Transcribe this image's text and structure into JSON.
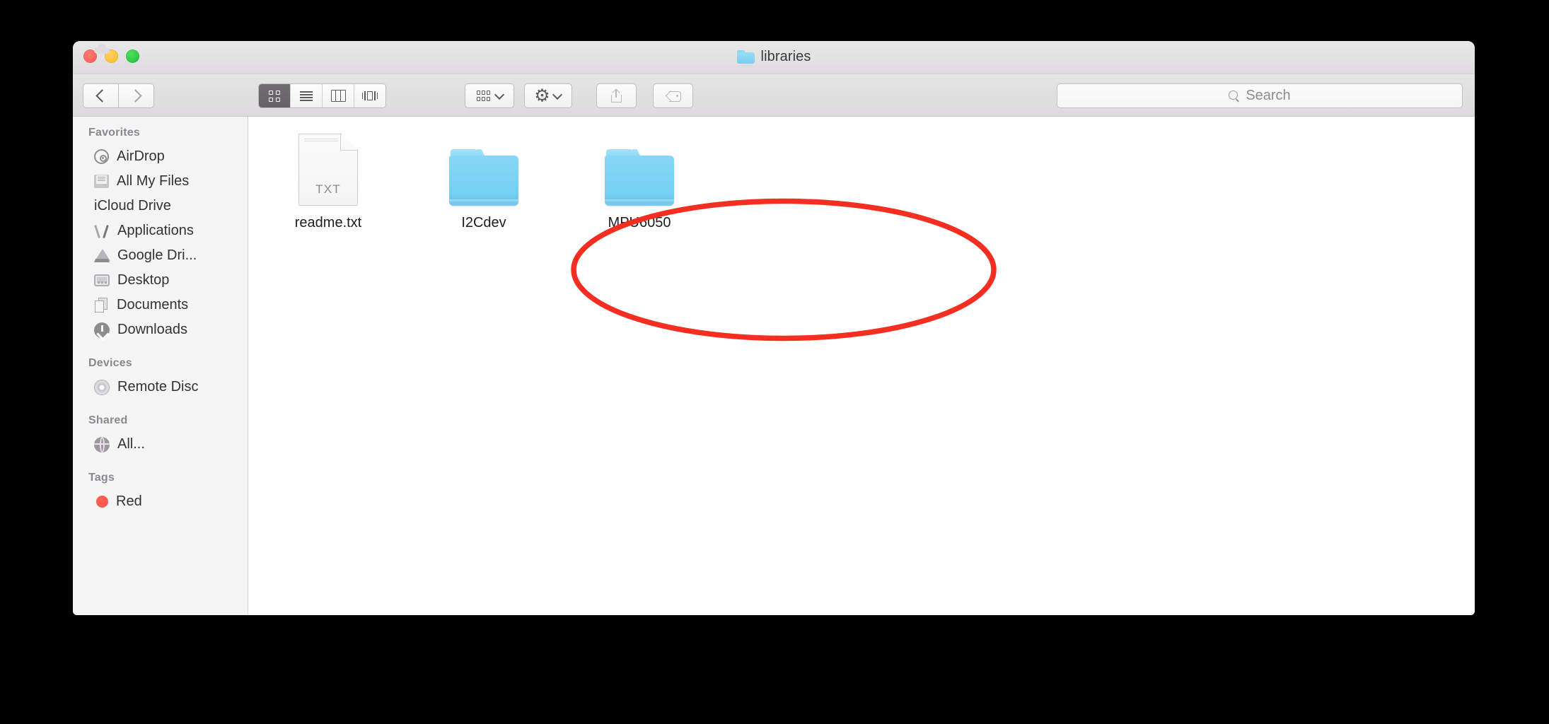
{
  "window": {
    "title": "libraries",
    "title_icon": "folder-icon",
    "traffic_lights": [
      {
        "name": "close",
        "color": "#fd5a50"
      },
      {
        "name": "minimize",
        "color": "#fcb71c"
      },
      {
        "name": "maximize",
        "color": "#1dbf32"
      }
    ]
  },
  "toolbar": {
    "nav": [
      {
        "name": "back",
        "icon": "chevron-left-icon"
      },
      {
        "name": "forward",
        "icon": "chevron-right-icon"
      }
    ],
    "view_modes": [
      {
        "name": "icon-view",
        "icon": "grid-icon",
        "active": true
      },
      {
        "name": "list-view",
        "icon": "list-icon",
        "active": false
      },
      {
        "name": "column-view",
        "icon": "columns-icon",
        "active": false
      },
      {
        "name": "cover-flow-view",
        "icon": "coverflow-icon",
        "active": false
      }
    ],
    "arrange": {
      "name": "arrange-by",
      "icon": "arrange-icon",
      "chevron": "chevron-down-icon"
    },
    "action": {
      "name": "action-menu",
      "icon": "gear-icon",
      "chevron": "chevron-down-icon"
    },
    "share": {
      "name": "share",
      "icon": "share-icon",
      "enabled": false
    },
    "tag": {
      "name": "add-tags",
      "icon": "tag-icon",
      "enabled": false
    }
  },
  "search": {
    "placeholder": "Search",
    "value": "",
    "icon": "search-icon"
  },
  "sidebar": {
    "sections": [
      {
        "header": "Favorites",
        "items": [
          {
            "label": "AirDrop",
            "icon": "airdrop-icon"
          },
          {
            "label": "All My Files",
            "icon": "all-my-files-icon"
          },
          {
            "label": "iCloud Drive",
            "icon": "icloud-icon"
          },
          {
            "label": "Applications",
            "icon": "applications-icon"
          },
          {
            "label": "Google Dri...",
            "icon": "google-drive-icon"
          },
          {
            "label": "Desktop",
            "icon": "desktop-icon"
          },
          {
            "label": "Documents",
            "icon": "documents-icon"
          },
          {
            "label": "Downloads",
            "icon": "downloads-icon"
          }
        ]
      },
      {
        "header": "Devices",
        "items": [
          {
            "label": "Remote Disc",
            "icon": "disc-icon"
          }
        ]
      },
      {
        "header": "Shared",
        "items": [
          {
            "label": "All...",
            "icon": "globe-icon"
          }
        ]
      },
      {
        "header": "Tags",
        "items": [
          {
            "label": "Red",
            "icon": "red-tag-icon"
          }
        ]
      }
    ]
  },
  "content": {
    "items": [
      {
        "label": "readme.txt",
        "kind": "text-file",
        "extension": "TXT"
      },
      {
        "label": "I2Cdev",
        "kind": "folder",
        "extension": ""
      },
      {
        "label": "MPU6050",
        "kind": "folder",
        "extension": ""
      }
    ]
  },
  "annotation": {
    "shape": "ellipse",
    "color": "#f42e20",
    "encircles": "I2Cdev and MPU6050 folders"
  }
}
